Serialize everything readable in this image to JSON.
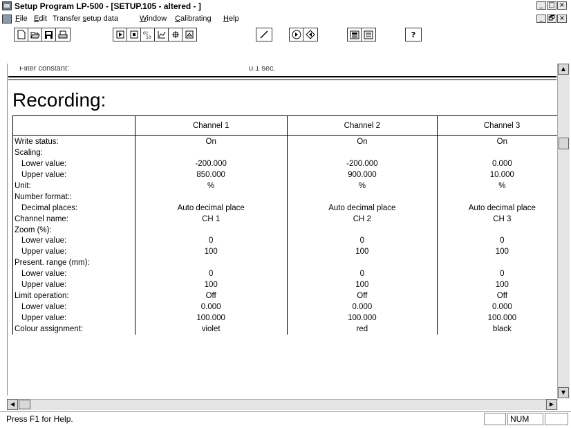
{
  "window": {
    "title": "Setup Program LP-500 - [SETUP.105 - altered - ]",
    "controls": [
      "_",
      "□",
      "×"
    ],
    "mdi_controls": [
      "_",
      "🗗",
      "×"
    ]
  },
  "menu": [
    {
      "label": "File",
      "u": "F",
      "rest": "ile"
    },
    {
      "label": "Edit",
      "u": "E",
      "rest": "dit"
    },
    {
      "label": "Transfer setup data",
      "pre": "Transfer ",
      "u": "s",
      "rest": "etup data"
    },
    {
      "label": "Window",
      "u": "W",
      "rest": "indow"
    },
    {
      "label": "Calibrating",
      "u": "C",
      "rest": "alibrating"
    },
    {
      "label": "Help",
      "u": "H",
      "rest": "elp"
    }
  ],
  "toolbar_icons": {
    "group1": [
      "new-icon",
      "open-icon",
      "save-icon",
      "print-icon"
    ],
    "group2": [
      "play-icon",
      "stop-icon",
      "binary-icon",
      "chart-icon",
      "transfer-icon",
      "record-icon"
    ],
    "group3": [
      "line-icon"
    ],
    "group4": [
      "download-icon",
      "upload-icon"
    ],
    "group5": [
      "device-icon",
      "list-icon"
    ],
    "group6": [
      "help-icon"
    ]
  },
  "cut_off": {
    "left": "Filter constant:",
    "right": "0.1 sec."
  },
  "section_title": "Recording:",
  "table": {
    "headers": [
      "",
      "Channel 1",
      "Channel 2",
      "Channel 3"
    ],
    "rows": [
      {
        "label": "Write status:",
        "indent": false,
        "values": [
          "On",
          "On",
          "On"
        ]
      },
      {
        "label": "Scaling:",
        "indent": false,
        "values": [
          "",
          "",
          ""
        ]
      },
      {
        "label": "Lower value:",
        "indent": true,
        "values": [
          "-200.000",
          "-200.000",
          "0.000"
        ]
      },
      {
        "label": "Upper value:",
        "indent": true,
        "values": [
          "850.000",
          "900.000",
          "10.000"
        ]
      },
      {
        "label": "Unit:",
        "indent": false,
        "values": [
          "%",
          "%",
          "%"
        ]
      },
      {
        "label": "Number format::",
        "indent": false,
        "values": [
          "",
          "",
          ""
        ]
      },
      {
        "label": "Decimal places:",
        "indent": true,
        "values": [
          "Auto decimal place",
          "Auto decimal place",
          "Auto decimal place"
        ]
      },
      {
        "label": "Channel name:",
        "indent": false,
        "values": [
          "CH 1",
          "CH 2",
          "CH 3"
        ]
      },
      {
        "label": "Zoom (%):",
        "indent": false,
        "values": [
          "",
          "",
          ""
        ]
      },
      {
        "label": "Lower value:",
        "indent": true,
        "values": [
          "0",
          "0",
          "0"
        ]
      },
      {
        "label": "Upper value:",
        "indent": true,
        "values": [
          "100",
          "100",
          "100"
        ]
      },
      {
        "label": "Present. range (mm):",
        "indent": false,
        "values": [
          "",
          "",
          ""
        ]
      },
      {
        "label": "Lower value:",
        "indent": true,
        "values": [
          "0",
          "0",
          "0"
        ]
      },
      {
        "label": "Upper value:",
        "indent": true,
        "values": [
          "100",
          "100",
          "100"
        ]
      },
      {
        "label": "Limit operation:",
        "indent": false,
        "values": [
          "Off",
          "Off",
          "Off"
        ]
      },
      {
        "label": "Lower value:",
        "indent": true,
        "values": [
          "0.000",
          "0.000",
          "0.000"
        ]
      },
      {
        "label": "Upper value:",
        "indent": true,
        "values": [
          "100.000",
          "100.000",
          "100.000"
        ]
      },
      {
        "label": "Colour assignment:",
        "indent": false,
        "values": [
          "violet",
          "red",
          "black"
        ]
      }
    ]
  },
  "status": {
    "help": "Press F1 for Help.",
    "num": "NUM"
  }
}
